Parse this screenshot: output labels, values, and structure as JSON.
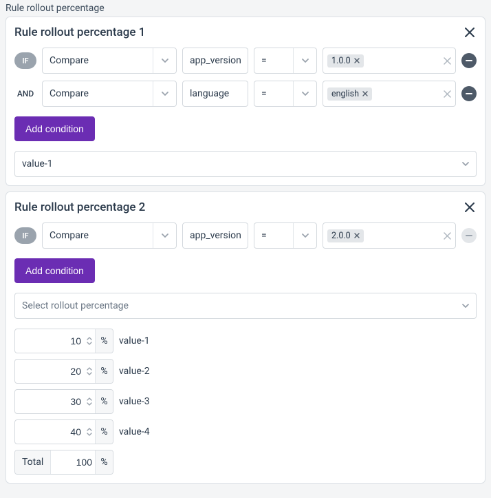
{
  "sectionTitle": "Rule rollout percentage",
  "percentSymbol": "%",
  "cards": [
    {
      "title": "Rule rollout percentage 1",
      "conditions": [
        {
          "joiner": "IF",
          "compare": "Compare",
          "field": "app_version",
          "op": "=",
          "tags": [
            "1.0.0"
          ]
        },
        {
          "joiner": "AND",
          "compare": "Compare",
          "field": "language",
          "op": "=",
          "tags": [
            "english"
          ]
        }
      ],
      "addConditionLabel": "Add condition",
      "valueSelect": "value-1"
    },
    {
      "title": "Rule rollout percentage 2",
      "conditions": [
        {
          "joiner": "IF",
          "compare": "Compare",
          "field": "app_version",
          "op": "=",
          "tags": [
            "2.0.0"
          ]
        }
      ],
      "addConditionLabel": "Add condition",
      "rolloutPlaceholder": "Select rollout percentage",
      "percentages": [
        {
          "value": "10",
          "label": "value-1"
        },
        {
          "value": "20",
          "label": "value-2"
        },
        {
          "value": "30",
          "label": "value-3"
        },
        {
          "value": "40",
          "label": "value-4"
        }
      ],
      "total": {
        "label": "Total",
        "value": "100"
      }
    }
  ]
}
